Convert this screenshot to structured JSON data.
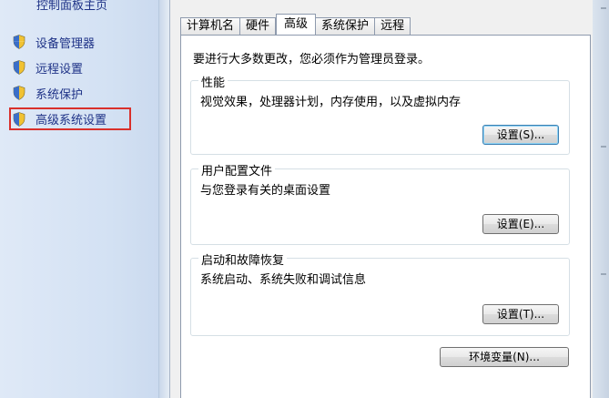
{
  "left_pane": {
    "home_label": "控制面板主页",
    "items": [
      {
        "label": "设备管理器",
        "icon": "shield-icon"
      },
      {
        "label": "远程设置",
        "icon": "shield-icon"
      },
      {
        "label": "系统保护",
        "icon": "shield-icon"
      },
      {
        "label": "高级系统设置",
        "icon": "shield-icon",
        "highlighted": true
      }
    ]
  },
  "dialog": {
    "tabs": [
      {
        "label": "计算机名"
      },
      {
        "label": "硬件"
      },
      {
        "label": "高级",
        "active": true
      },
      {
        "label": "系统保护"
      },
      {
        "label": "远程"
      }
    ],
    "notice": "要进行大多数更改，您必须作为管理员登录。",
    "groups": {
      "performance": {
        "title": "性能",
        "description": "视觉效果，处理器计划，内存使用，以及虚拟内存",
        "button": "设置(S)..."
      },
      "user_profiles": {
        "title": "用户配置文件",
        "description": "与您登录有关的桌面设置",
        "button": "设置(E)..."
      },
      "startup_recovery": {
        "title": "启动和故障恢复",
        "description": "系统启动、系统失败和调试信息",
        "button": "设置(T)..."
      }
    },
    "env_button": "环境变量(N)..."
  },
  "colors": {
    "link": "#1e3287",
    "highlight_border": "#d9302b",
    "dialog_bg": "#f0f0f0",
    "focus_border": "#3c7fb1"
  }
}
